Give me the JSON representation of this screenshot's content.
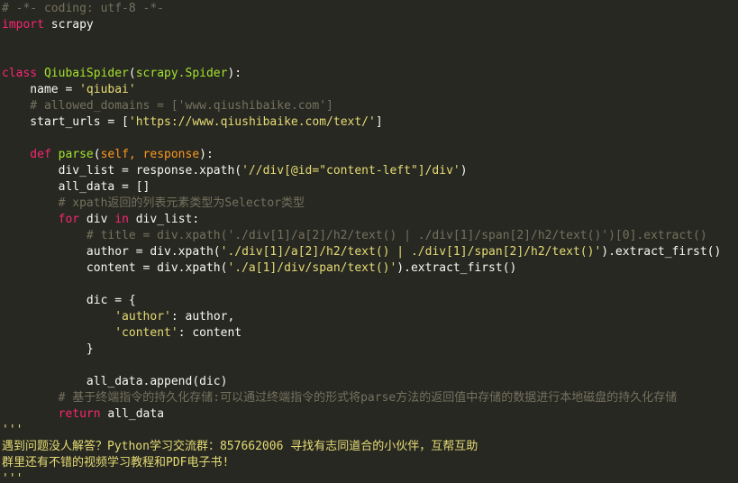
{
  "editor": {
    "language": "python",
    "theme_colors": {
      "background": "#272822",
      "comment": "#75715e",
      "keyword": "#f92672",
      "string": "#e6db74",
      "function": "#a6e22e",
      "param": "#fd971f",
      "text": "#f8f8f2"
    },
    "lines": [
      [
        {
          "t": "# -*- coding: utf-8 -*-",
          "c": "comment"
        }
      ],
      [
        {
          "t": "import",
          "c": "kw"
        },
        {
          "t": " scrapy",
          "c": "plain"
        }
      ],
      [],
      [],
      [
        {
          "t": "class ",
          "c": "kw"
        },
        {
          "t": "QiubaiSpider",
          "c": "cls"
        },
        {
          "t": "(",
          "c": "plain"
        },
        {
          "t": "scrapy.Spider",
          "c": "cls"
        },
        {
          "t": "):",
          "c": "plain"
        }
      ],
      [
        {
          "t": "    name = ",
          "c": "plain"
        },
        {
          "t": "'qiubai'",
          "c": "str"
        }
      ],
      [
        {
          "t": "    # allowed_domains = ['www.qiushibaike.com']",
          "c": "comment"
        }
      ],
      [
        {
          "t": "    start_urls = [",
          "c": "plain"
        },
        {
          "t": "'https://www.qiushibaike.com/text/'",
          "c": "str"
        },
        {
          "t": "]",
          "c": "plain"
        }
      ],
      [],
      [
        {
          "t": "    def ",
          "c": "kw"
        },
        {
          "t": "parse",
          "c": "fn"
        },
        {
          "t": "(",
          "c": "plain"
        },
        {
          "t": "self, response",
          "c": "param"
        },
        {
          "t": "):",
          "c": "plain"
        }
      ],
      [
        {
          "t": "        div_list = response.xpath(",
          "c": "plain"
        },
        {
          "t": "'//div[@id=\"content-left\"]/div'",
          "c": "str"
        },
        {
          "t": ")",
          "c": "plain"
        }
      ],
      [
        {
          "t": "        all_data = []",
          "c": "plain"
        }
      ],
      [
        {
          "t": "        # xpath返回的列表元素类型为Selector类型",
          "c": "comment"
        }
      ],
      [
        {
          "t": "        ",
          "c": "plain"
        },
        {
          "t": "for",
          "c": "kw"
        },
        {
          "t": " div ",
          "c": "plain"
        },
        {
          "t": "in",
          "c": "kw"
        },
        {
          "t": " div_list:",
          "c": "plain"
        }
      ],
      [
        {
          "t": "            # title = div.xpath('./div[1]/a[2]/h2/text() | ./div[1]/span[2]/h2/text()')[0].extract()",
          "c": "comment"
        }
      ],
      [
        {
          "t": "            author = div.xpath(",
          "c": "plain"
        },
        {
          "t": "'./div[1]/a[2]/h2/text() | ./div[1]/span[2]/h2/text()'",
          "c": "str"
        },
        {
          "t": ").extract_first()",
          "c": "plain"
        }
      ],
      [
        {
          "t": "            content = div.xpath(",
          "c": "plain"
        },
        {
          "t": "'./a[1]/div/span/text()'",
          "c": "str"
        },
        {
          "t": ").extract_first()",
          "c": "plain"
        }
      ],
      [],
      [
        {
          "t": "            dic = {",
          "c": "plain"
        }
      ],
      [
        {
          "t": "                ",
          "c": "plain"
        },
        {
          "t": "'author'",
          "c": "str"
        },
        {
          "t": ": author,",
          "c": "plain"
        }
      ],
      [
        {
          "t": "                ",
          "c": "plain"
        },
        {
          "t": "'content'",
          "c": "str"
        },
        {
          "t": ": content",
          "c": "plain"
        }
      ],
      [
        {
          "t": "            }",
          "c": "plain"
        }
      ],
      [],
      [
        {
          "t": "            all_data.append(dic)",
          "c": "plain"
        }
      ],
      [
        {
          "t": "        # 基于终端指令的持久化存储:可以通过终端指令的形式将parse方法的返回值中存储的数据进行本地磁盘的持久化存储",
          "c": "comment"
        }
      ],
      [
        {
          "t": "        ",
          "c": "plain"
        },
        {
          "t": "return",
          "c": "kw"
        },
        {
          "t": " all_data",
          "c": "plain"
        }
      ],
      [
        {
          "t": "'''",
          "c": "doc"
        }
      ],
      [
        {
          "t": "遇到问题没人解答？Python学习交流群：857662006 寻找有志同道合的小伙伴，互帮互助",
          "c": "doc"
        }
      ],
      [
        {
          "t": "群里还有不错的视频学习教程和PDF电子书!",
          "c": "doc"
        }
      ],
      [
        {
          "t": "'''",
          "c": "doc"
        }
      ]
    ]
  }
}
